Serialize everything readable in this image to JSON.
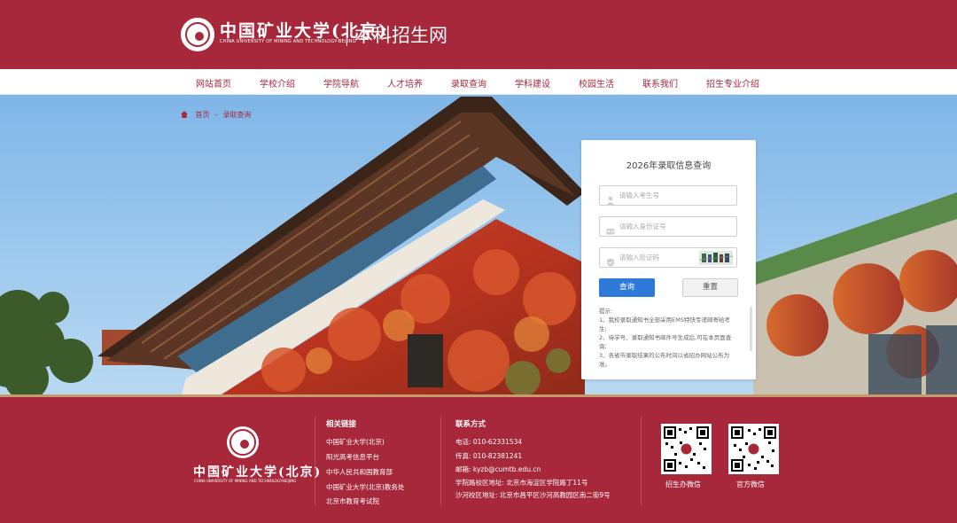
{
  "header": {
    "logo_cn": "中国矿业大学(北京)",
    "logo_en": "CHINA UNIVERSITY OF MINING AND TECHNOLOGY-BEIJING",
    "site_title": "本科招生网",
    "bg_color": "#a6283a"
  },
  "nav": {
    "items": [
      {
        "label": "网站首页"
      },
      {
        "label": "学校介绍"
      },
      {
        "label": "学院导航"
      },
      {
        "label": "人才培养"
      },
      {
        "label": "录取查询"
      },
      {
        "label": "学科建设"
      },
      {
        "label": "校园生活"
      },
      {
        "label": "联系我们"
      },
      {
        "label": "招生专业介绍"
      }
    ]
  },
  "breadcrumb": {
    "home": "首页",
    "separator": "-",
    "current": "录取查询"
  },
  "query_card": {
    "title": "2026年录取信息查询",
    "exam_no_placeholder": "请输入考生号",
    "id_no_placeholder": "请输入身份证号",
    "captcha_placeholder": "请输入验证码",
    "query_button": "查询",
    "reset_button": "重置",
    "tips": [
      "提示:",
      "1、我校录取通知书全部采用EMS特快专递邮寄给考生;",
      "2、待学号、录取通知书邮件号生成后,可在本页面查询;",
      "3、各省市录取结果的公布时间以省招办网站公布为准。"
    ],
    "accent_color": "#2f7ad8"
  },
  "footer": {
    "logo_cn": "中国矿业大学(北京)",
    "logo_en": "CHINA UNIVERSITY OF MINING AND TECHNOLOGY-BEIJING",
    "links_heading": "相关链接",
    "links": [
      "中国矿业大学(北京)",
      "阳光高考信息平台",
      "中华人民共和国教育部",
      "中国矿业大学(北京)教务处",
      "北京市教育考试院"
    ],
    "contact_heading": "联系方式",
    "contact": [
      "电话:  010-62331534",
      "传真:  010-82381241",
      "邮箱:  kyzb@cumtb.edu.cn",
      "学院路校区地址:  北京市海淀区学院路丁11号",
      "沙河校区地址:  北京市昌平区沙河高教园区南二街9号"
    ],
    "qr_codes": [
      {
        "label": "招生办微信"
      },
      {
        "label": "官方微信"
      }
    ]
  }
}
